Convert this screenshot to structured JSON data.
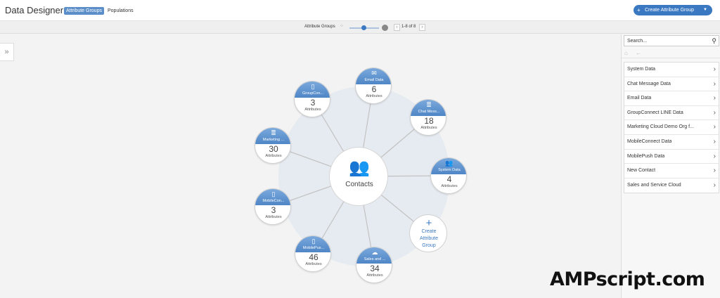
{
  "header": {
    "title": "Data Designer",
    "tabs": [
      {
        "label": "Attribute Groups",
        "active": true
      },
      {
        "label": "Populations",
        "active": false
      }
    ],
    "create_button": "Create Attribute Group",
    "create_button_icon": "plus-icon",
    "accent_color": "#3a78c2"
  },
  "toolbar": {
    "label": "Attribute Groups",
    "page_indicator": "1-8 of 8",
    "prev_icon": "chevron-left-icon",
    "next_icon": "chevron-right-icon"
  },
  "canvas": {
    "center_label": "Contacts",
    "center_icon": "people-icon",
    "attributes_label": "Attributes",
    "create_node_label": "Create\nAttribute\nGroup",
    "nodes": [
      {
        "name": "Email Data",
        "count": "6",
        "icon": "envelope-icon"
      },
      {
        "name": "Chat Mess...",
        "count": "18",
        "icon": "database-icon"
      },
      {
        "name": "System Data",
        "count": "4",
        "icon": "people-icon"
      },
      {
        "name": "Sales and ...",
        "count": "34",
        "icon": "cloud-icon"
      },
      {
        "name": "MobilePus...",
        "count": "46",
        "icon": "mobile-icon"
      },
      {
        "name": "MobileCon...",
        "count": "3",
        "icon": "mobile-icon"
      },
      {
        "name": "Marketing ...",
        "count": "30",
        "icon": "database-icon"
      },
      {
        "name": "GroupCon...",
        "count": "3",
        "icon": "mobile-icon"
      }
    ]
  },
  "sidebar": {
    "search_placeholder": "Search...",
    "items": [
      {
        "label": "System Data"
      },
      {
        "label": "Chat Message Data"
      },
      {
        "label": "Email Data"
      },
      {
        "label": "GroupConnect LINE Data"
      },
      {
        "label": "Marketing Cloud Demo Org f..."
      },
      {
        "label": "MobileConnect Data"
      },
      {
        "label": "MobilePush Data"
      },
      {
        "label": "New Contact"
      },
      {
        "label": "Sales and Service Cloud"
      }
    ]
  },
  "watermark": "AMPscript.com"
}
